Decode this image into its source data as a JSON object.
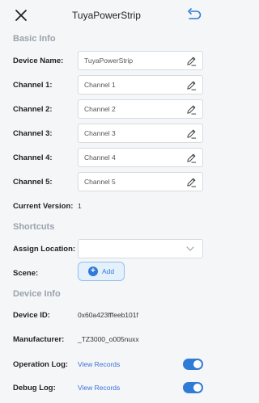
{
  "header": {
    "title": "TuyaPowerStrip"
  },
  "basic_info": {
    "heading": "Basic Info",
    "device_name": {
      "label": "Device Name:",
      "value": "TuyaPowerStrip"
    },
    "channels": [
      {
        "label": "Channel 1:",
        "value": "Channel 1"
      },
      {
        "label": "Channel 2:",
        "value": "Channel 2"
      },
      {
        "label": "Channel 3:",
        "value": "Channel 3"
      },
      {
        "label": "Channel 4:",
        "value": "Channel 4"
      },
      {
        "label": "Channel 5:",
        "value": "Channel 5"
      }
    ],
    "current_version": {
      "label": "Current Version:",
      "value": "1"
    }
  },
  "shortcuts": {
    "heading": "Shortcuts",
    "assign_location": {
      "label": "Assign Location:",
      "value": ""
    },
    "scene": {
      "label": "Scene:",
      "button": "Add"
    }
  },
  "device_info": {
    "heading": "Device Info",
    "device_id": {
      "label": "Device ID:",
      "value": "0x60a423fffeeb101f"
    },
    "manufacturer": {
      "label": "Manufacturer:",
      "value": "_TZ3000_o005nuxx"
    },
    "operation_log": {
      "label": "Operation Log:",
      "link": "View Records",
      "enabled": true
    },
    "debug_log": {
      "label": "Debug Log:",
      "link": "View Records",
      "enabled": true
    }
  },
  "colors": {
    "accent": "#2f7bd6",
    "link": "#3f6fd6",
    "section": "#9aa3ad"
  },
  "icons": {
    "close": "close-icon",
    "undo": "undo-icon",
    "edit": "pencil-icon",
    "dropdown": "chevron-down-icon"
  }
}
